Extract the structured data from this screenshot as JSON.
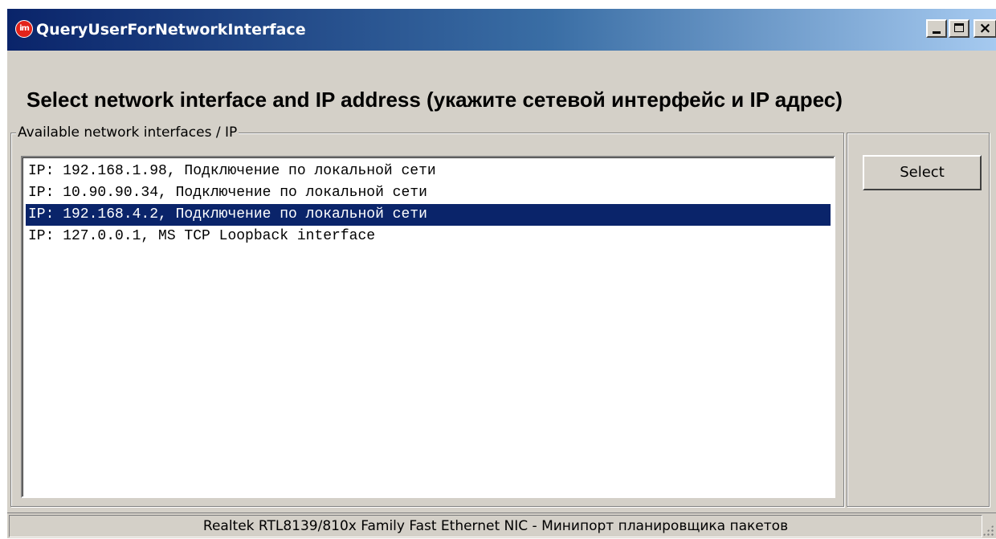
{
  "window": {
    "title": "QueryUserForNetworkInterface",
    "icon": "im-app-icon",
    "icon_text": "im",
    "controls": {
      "minimize": "minimize-icon",
      "maximize": "maximize-icon",
      "close": "close-icon",
      "close_glyph": "×"
    }
  },
  "heading": "Select network interface and IP address (укажите сетевой интерфейс и IP адрес)",
  "groupbox": {
    "legend": "Available network interfaces / IP"
  },
  "interfaces": [
    {
      "label": "IP: 192.168.1.98, Подключение по локальной сети",
      "selected": false
    },
    {
      "label": "IP: 10.90.90.34, Подключение по локальной сети",
      "selected": false
    },
    {
      "label": "IP: 192.168.4.2, Подключение по локальной сети",
      "selected": true
    },
    {
      "label": "IP: 127.0.0.1, MS TCP Loopback interface",
      "selected": false
    }
  ],
  "actions": {
    "select_label": "Select"
  },
  "status": {
    "text": "Realtek RTL8139/810x Family Fast Ethernet NIC - Минипорт планировщика пакетов"
  },
  "colors": {
    "selection": "#0a246a",
    "face": "#d4d0c8",
    "icon_red": "#e3231a"
  }
}
